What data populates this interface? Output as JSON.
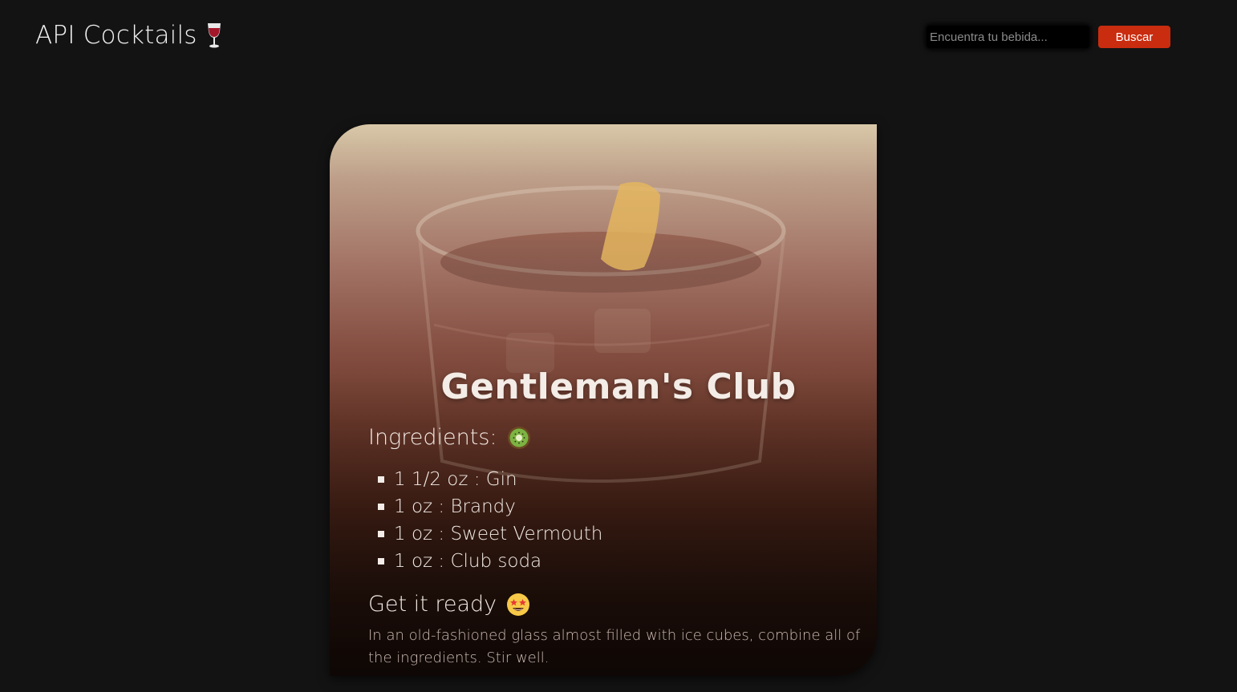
{
  "header": {
    "brand_title": "API Cocktails",
    "brand_icon": "wine-glass-icon"
  },
  "search": {
    "placeholder": "Encuentra tu bebida...",
    "value": "",
    "button_label": "Buscar",
    "button_color": "#c92c0f"
  },
  "drink": {
    "name": "Gentleman's Club",
    "ingredients_heading": "Ingredients:",
    "ingredients_icon": "kiwi-icon",
    "ingredients": [
      "1 1/2 oz : Gin",
      "1 oz : Brandy",
      "1 oz : Sweet Vermouth",
      "1 oz : Club soda"
    ],
    "prep_heading": "Get it ready",
    "prep_icon": "star-struck-face-icon",
    "instructions": "In an old-fashioned glass almost filled with ice cubes, combine all of the ingredients. Stir well."
  },
  "colors": {
    "background": "#131313",
    "card_top": "#d8c8a8",
    "card_bottom": "#1e0f0a"
  }
}
